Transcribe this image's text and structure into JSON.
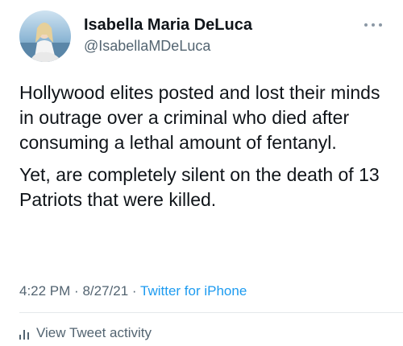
{
  "author": {
    "display_name": "Isabella Maria DeLuca",
    "handle": "@IsabellaMDeLuca",
    "avatar_icon": "profile-photo"
  },
  "tweet": {
    "paragraphs": [
      "Hollywood elites posted and lost their minds in outrage over a criminal who died after consuming a lethal amount of fentanyl.",
      "Yet, are completely silent on the death of 13 Patriots that were killed."
    ],
    "time": "4:22 PM",
    "date": "8/27/21",
    "separator": "·",
    "source": "Twitter for iPhone"
  },
  "actions": {
    "more_icon": "more-horizontal-icon",
    "activity_label": "View Tweet activity",
    "activity_icon": "bar-chart-icon"
  },
  "colors": {
    "text": "#0f1419",
    "secondary": "#536471",
    "link": "#1d9bf0",
    "divider": "#e4e8eb"
  }
}
